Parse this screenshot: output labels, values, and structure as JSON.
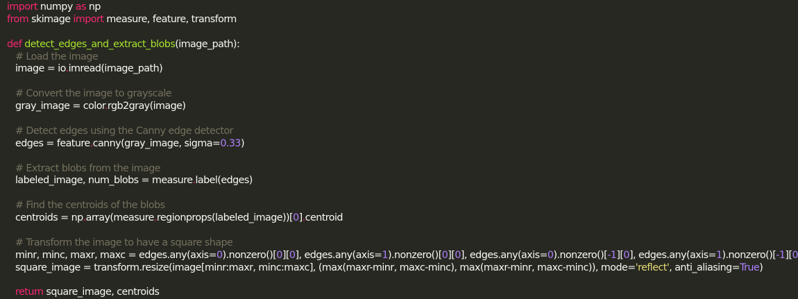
{
  "colors": {
    "background": "#272822",
    "default_text": "#f8f8f2",
    "keyword": "#f92672",
    "function_name": "#a6e22e",
    "comment": "#75715e",
    "number": "#ae81ff",
    "string": "#e6db74",
    "builtin": "#66d9ef"
  },
  "code": {
    "l1": {
      "import": "import",
      "module": " numpy ",
      "as": "as",
      "alias": " np"
    },
    "l2": {
      "from": "from",
      "module": " skimage ",
      "import": "import",
      "names": " measure, feature, transform"
    },
    "l4": {
      "def": "def",
      "fname": " detect_edges_and_extract_blobs",
      "params": "(image_path):"
    },
    "l5": {
      "comment": "# Load the image"
    },
    "l6": {
      "a": "image = io",
      "b": ".",
      "c": "imread(image_path)"
    },
    "l8": {
      "comment": "# Convert the image to grayscale"
    },
    "l9": {
      "a": "gray_image = color",
      "b": ".",
      "c": "rgb2gray(image)"
    },
    "l11": {
      "comment": "# Detect edges using the Canny edge detector"
    },
    "l12": {
      "a": "edges = feature",
      "b": ".",
      "c": "canny(gray_image, sigma=",
      "num": "0.33",
      "d": ")"
    },
    "l14": {
      "comment": "# Extract blobs from the image"
    },
    "l15": {
      "a": "labeled_image, num_blobs = measure",
      "b": ".",
      "c": "label(edges)"
    },
    "l17": {
      "comment": "# Find the centroids of the blobs"
    },
    "l18": {
      "a": "centroids = np",
      "b": ".",
      "c": "array(measure",
      "d": ".",
      "e": "regionprops(labeled_image))[",
      "num": "0",
      "f": "]",
      "g": ".",
      "h": "centroid"
    },
    "l20": {
      "comment": "# Transform the image to have a square shape"
    },
    "l21": {
      "p1": "minr, minc, maxr, maxc = edges.any(axis=",
      "n1": "0",
      "p2": ").nonzero()[",
      "n2": "0",
      "p3": "][",
      "n3": "0",
      "p4": "], edges.any(axis=",
      "n4": "1",
      "p5": ").nonzero()[",
      "n5": "0",
      "p6": "][",
      "n6": "0",
      "p7": "], edges.any(axis=",
      "n7": "0",
      "p8": ").nonzero()[",
      "n8": "-1",
      "p9": "][",
      "n9": "0",
      "p10": "], edges.any(axis=",
      "n10": "1",
      "p11": ").nonzero()[",
      "n11": "-1",
      "p12": "][",
      "n12": "0",
      "p13": "]"
    },
    "l22": {
      "a": "square_image = transform.resize(image[minr:maxr, minc:maxc], (max(maxr-minr, maxc-minc), max(maxr-minr, maxc-minc)), mode=",
      "str": "'reflect'",
      "b": ", anti_aliasing=",
      "bool": "True",
      "c": ")"
    },
    "l24": {
      "return": "return",
      "rest": " square_image, centroids"
    }
  }
}
